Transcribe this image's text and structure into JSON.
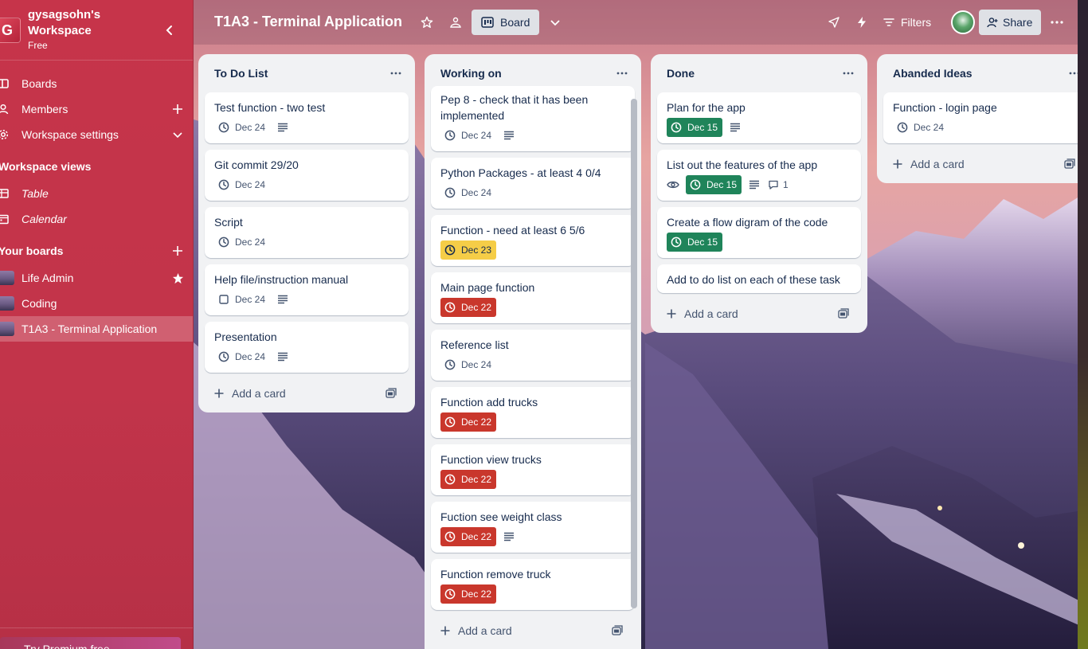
{
  "workspace": {
    "logo_letter": "G",
    "name": "gysagsohn's Workspace",
    "plan": "Free"
  },
  "sidebar": {
    "items": [
      {
        "label": "Boards",
        "icon": "board-icon"
      },
      {
        "label": "Members",
        "icon": "member-icon"
      },
      {
        "label": "Workspace settings",
        "icon": "gear-icon"
      }
    ],
    "views_title": "Workspace views",
    "views": [
      {
        "label": "Table",
        "icon": "table-icon"
      },
      {
        "label": "Calendar",
        "icon": "calendar-icon"
      }
    ],
    "boards_title": "Your boards",
    "boards": [
      {
        "label": "Life Admin",
        "starred": true
      },
      {
        "label": "Coding",
        "starred": false
      },
      {
        "label": "T1A3 - Terminal Application",
        "starred": false,
        "active": true
      }
    ],
    "premium_label": "Try Premium free"
  },
  "topbar": {
    "title": "T1A3 - Terminal Application",
    "view_label": "Board",
    "filters_label": "Filters",
    "share_label": "Share"
  },
  "lists": [
    {
      "title": "To Do List",
      "add_card": "Add a card",
      "cards": [
        {
          "title": "Test function - two test",
          "due": "Dec 24",
          "due_style": "plain",
          "description": true
        },
        {
          "title": "Git commit 29/20",
          "due": "Dec 24",
          "due_style": "plain"
        },
        {
          "title": "Script",
          "due": "Dec 24",
          "due_style": "plain"
        },
        {
          "title": "Help file/instruction manual",
          "due": "Dec 24",
          "due_style": "checkbox",
          "description": true
        },
        {
          "title": "Presentation",
          "due": "Dec 24",
          "due_style": "plain",
          "description": true
        }
      ]
    },
    {
      "title": "Working on",
      "add_card": "Add a card",
      "cards": [
        {
          "title": "Pep 8 - check that it has been implemented",
          "due": "Dec 24",
          "due_style": "plain",
          "description": true
        },
        {
          "title": "Python Packages - at least 4 0/4",
          "due": "Dec 24",
          "due_style": "plain"
        },
        {
          "title": "Function - need at least 6 5/6",
          "due": "Dec 23",
          "due_style": "yellow"
        },
        {
          "title": "Main page function",
          "due": "Dec 22",
          "due_style": "red"
        },
        {
          "title": "Reference list",
          "due": "Dec 24",
          "due_style": "plain"
        },
        {
          "title": "Function add trucks",
          "due": "Dec 22",
          "due_style": "red"
        },
        {
          "title": "Function view trucks",
          "due": "Dec 22",
          "due_style": "red"
        },
        {
          "title": "Fuction see weight class",
          "due": "Dec 22",
          "due_style": "red",
          "description": true
        },
        {
          "title": "Function remove truck",
          "due": "Dec 22",
          "due_style": "red"
        }
      ]
    },
    {
      "title": "Done",
      "add_card": "Add a card",
      "cards": [
        {
          "title": "Plan for the app",
          "due": "Dec 15",
          "due_style": "green",
          "description": true
        },
        {
          "title": "List out the features of the app",
          "due": "Dec 15",
          "due_style": "green",
          "watching": true,
          "description": true,
          "comments": "1"
        },
        {
          "title": "Create a flow digram of the code",
          "due": "Dec 15",
          "due_style": "green"
        },
        {
          "title": "Add to do list on each of these task"
        }
      ]
    },
    {
      "title": "Abanded Ideas",
      "add_card": "Add a card",
      "cards": [
        {
          "title": "Function - login page",
          "due": "Dec 24",
          "due_style": "plain"
        }
      ]
    }
  ],
  "colors": {
    "sidebar": "#c6344a",
    "list_bg": "#f1f2f4",
    "due_red": "#c9372c",
    "due_green": "#1f845a",
    "due_yellow": "#f5cd47"
  }
}
